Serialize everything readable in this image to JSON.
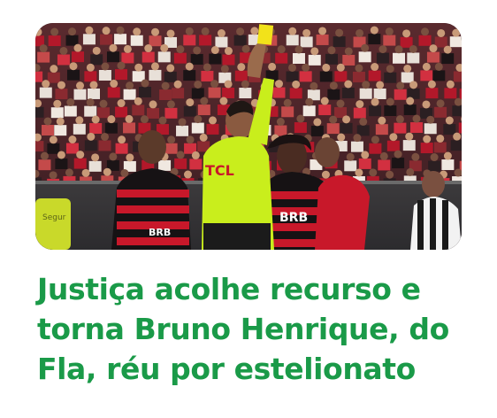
{
  "article": {
    "headline_lines": [
      "Justiça acolhe recurso e",
      "torna Bruno Henrique, do",
      "Fla, réu por estelionato"
    ],
    "headline_color": "#1a9a48"
  },
  "photo": {
    "jersey_sponsor": "TCL",
    "shirt_brand_text": "BRB",
    "stand_sign_text": "Segur",
    "card_color": "#f2e21a",
    "referee_shirt_color": "#c9ee1c",
    "flamengo_red": "#c8182a"
  }
}
